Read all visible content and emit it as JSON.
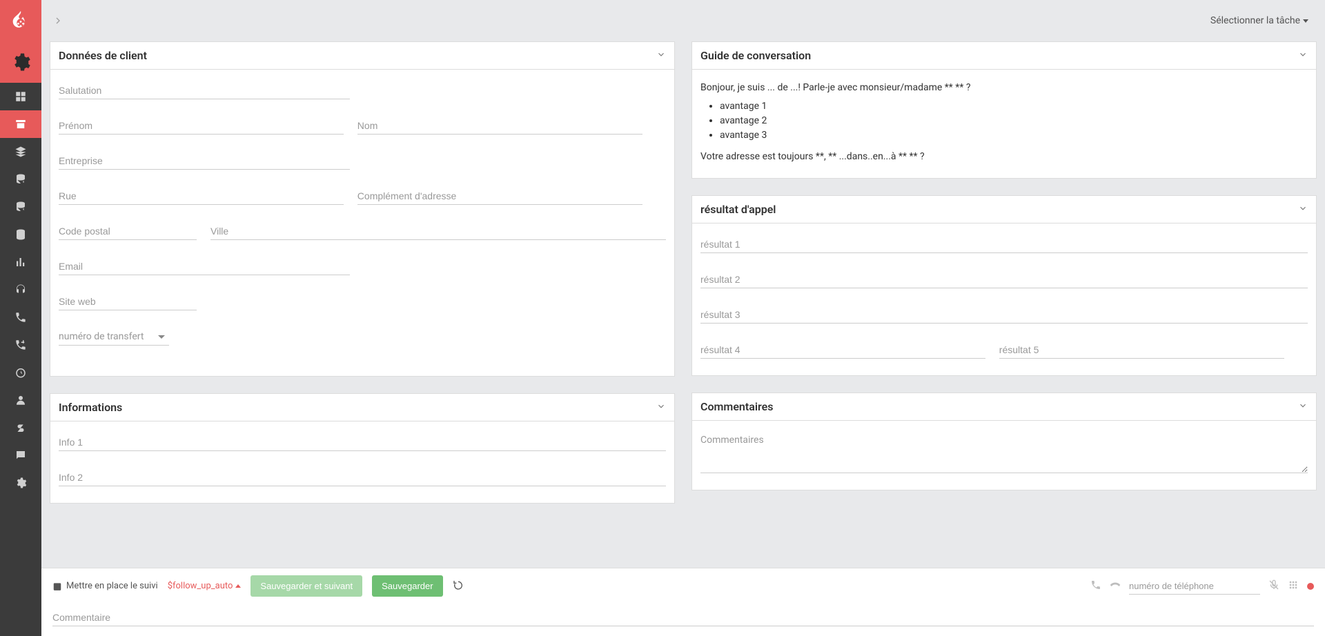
{
  "topbar": {
    "task_select_label": "Sélectionner la tâche"
  },
  "panels": {
    "client": {
      "title": "Données de client",
      "fields": {
        "salutation": "Salutation",
        "firstname": "Prénom",
        "lastname": "Nom",
        "company": "Entreprise",
        "street": "Rue",
        "address2": "Complément d'adresse",
        "zip": "Code postal",
        "city": "Ville",
        "email": "Email",
        "website": "Site web",
        "transfer_number": "numéro de transfert"
      }
    },
    "info": {
      "title": "Informations",
      "fields": {
        "info1": "Info 1",
        "info2": "Info 2"
      }
    },
    "guide": {
      "title": "Guide de conversation",
      "intro": "Bonjour, je suis ... de ...! Parle-je avec monsieur/madame ** ** ?",
      "bullets": [
        "avantage 1",
        "avantage 2",
        "avantage 3"
      ],
      "outro": "Votre adresse est toujours **, ** ...dans..en...à ** ** ?"
    },
    "result": {
      "title": "résultat d'appel",
      "fields": {
        "r1": "résultat 1",
        "r2": "résultat 2",
        "r3": "résultat 3",
        "r4": "résultat 4",
        "r5": "résultat 5"
      }
    },
    "comments": {
      "title": "Commentaires",
      "placeholder": "Commentaires"
    }
  },
  "footer": {
    "followup_label": "Mettre en place le suivi",
    "followup_auto": "$follow_up_auto",
    "save_next": "Sauvegarder et suivant",
    "save": "Sauvegarder",
    "phone_placeholder": "numéro de téléphone",
    "comment_placeholder": "Commentaire"
  }
}
